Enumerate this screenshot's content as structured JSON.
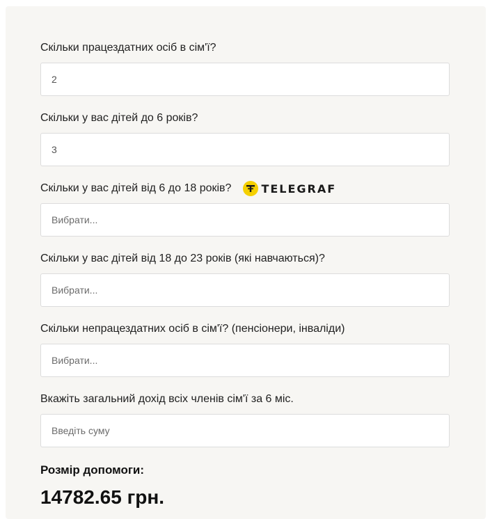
{
  "form": {
    "fields": [
      {
        "label": "Скільки працездатних осіб в сім'ї?",
        "value": "2",
        "placeholder": ""
      },
      {
        "label": "Скільки у вас дітей до 6 років?",
        "value": "3",
        "placeholder": ""
      },
      {
        "label": "Скільки у вас дітей від 6 до 18 років?",
        "value": "",
        "placeholder": "Вибрати..."
      },
      {
        "label": "Скільки у вас дітей від 18 до 23 років (які навчаються)?",
        "value": "",
        "placeholder": "Вибрати..."
      },
      {
        "label": "Скільки непрацездатних осіб в сім'ї? (пенсіонери, інваліди)",
        "value": "",
        "placeholder": "Вибрати..."
      },
      {
        "label": "Вкажіть загальний дохід всіх членів сім'ї за 6 міс.",
        "value": "",
        "placeholder": "Введіть суму"
      }
    ]
  },
  "watermark": {
    "text": "TELEGRAF",
    "icon": "telegraf-logo-icon",
    "color": "#f5d000"
  },
  "result": {
    "label": "Розмір допомоги:",
    "value": "14782.65 грн."
  }
}
